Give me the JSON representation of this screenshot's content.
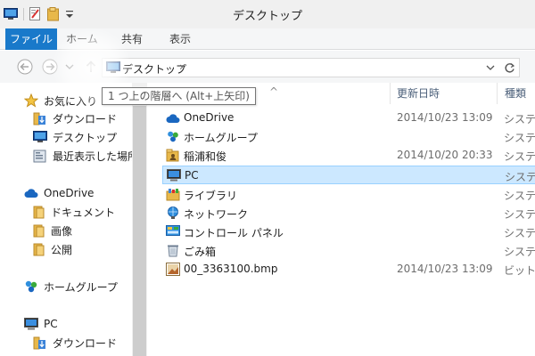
{
  "window": {
    "title": "デスクトップ"
  },
  "ribbon": {
    "tabs": [
      "ファイル",
      "ホーム",
      "共有",
      "表示"
    ]
  },
  "address": {
    "crumb": "デスクトップ",
    "separator": "›"
  },
  "tooltip": {
    "text": "1 つ上の階層へ (Alt+上矢印)"
  },
  "navpane": {
    "items": [
      {
        "label": "お気に入り",
        "icon": "star-icon"
      },
      {
        "label": "ダウンロード",
        "icon": "download-folder-icon"
      },
      {
        "label": "デスクトップ",
        "icon": "desktop-icon"
      },
      {
        "label": "最近表示した場所",
        "icon": "recent-places-icon"
      },
      {
        "label": "OneDrive",
        "icon": "cloud-icon"
      },
      {
        "label": "ドキュメント",
        "icon": "folder-icon"
      },
      {
        "label": "画像",
        "icon": "folder-icon"
      },
      {
        "label": "公開",
        "icon": "folder-icon"
      },
      {
        "label": "ホームグループ",
        "icon": "homegroup-icon"
      },
      {
        "label": "PC",
        "icon": "pc-icon"
      },
      {
        "label": "ダウンロード",
        "icon": "download-folder-icon"
      }
    ]
  },
  "columns": {
    "name_sort_indicator": "^",
    "modified": "更新日時",
    "type": "種類"
  },
  "files": [
    {
      "name": "OneDrive",
      "date": "2014/10/23 13:09",
      "type": "システム",
      "icon": "cloud-icon"
    },
    {
      "name": "ホームグループ",
      "date": "",
      "type": "システム",
      "icon": "homegroup-icon"
    },
    {
      "name": "稲浦和俊",
      "date": "2014/10/20 20:33",
      "type": "システム",
      "icon": "user-folder-icon"
    },
    {
      "name": "PC",
      "date": "",
      "type": "システム",
      "icon": "pc-icon"
    },
    {
      "name": "ライブラリ",
      "date": "",
      "type": "システム",
      "icon": "library-icon"
    },
    {
      "name": "ネットワーク",
      "date": "",
      "type": "システム",
      "icon": "network-icon"
    },
    {
      "name": "コントロール パネル",
      "date": "",
      "type": "システム",
      "icon": "control-panel-icon"
    },
    {
      "name": "ごみ箱",
      "date": "",
      "type": "システム",
      "icon": "recycle-bin-icon"
    },
    {
      "name": "00_3363100.bmp",
      "date": "2014/10/23 13:09",
      "type": "ビットマップ",
      "icon": "bitmap-icon"
    }
  ],
  "selected_file_index": 3,
  "colors": {
    "accent": "#1979ca",
    "selection": "#cce8ff",
    "selection_border": "#99d1ff",
    "folder": "#e8b84a"
  }
}
